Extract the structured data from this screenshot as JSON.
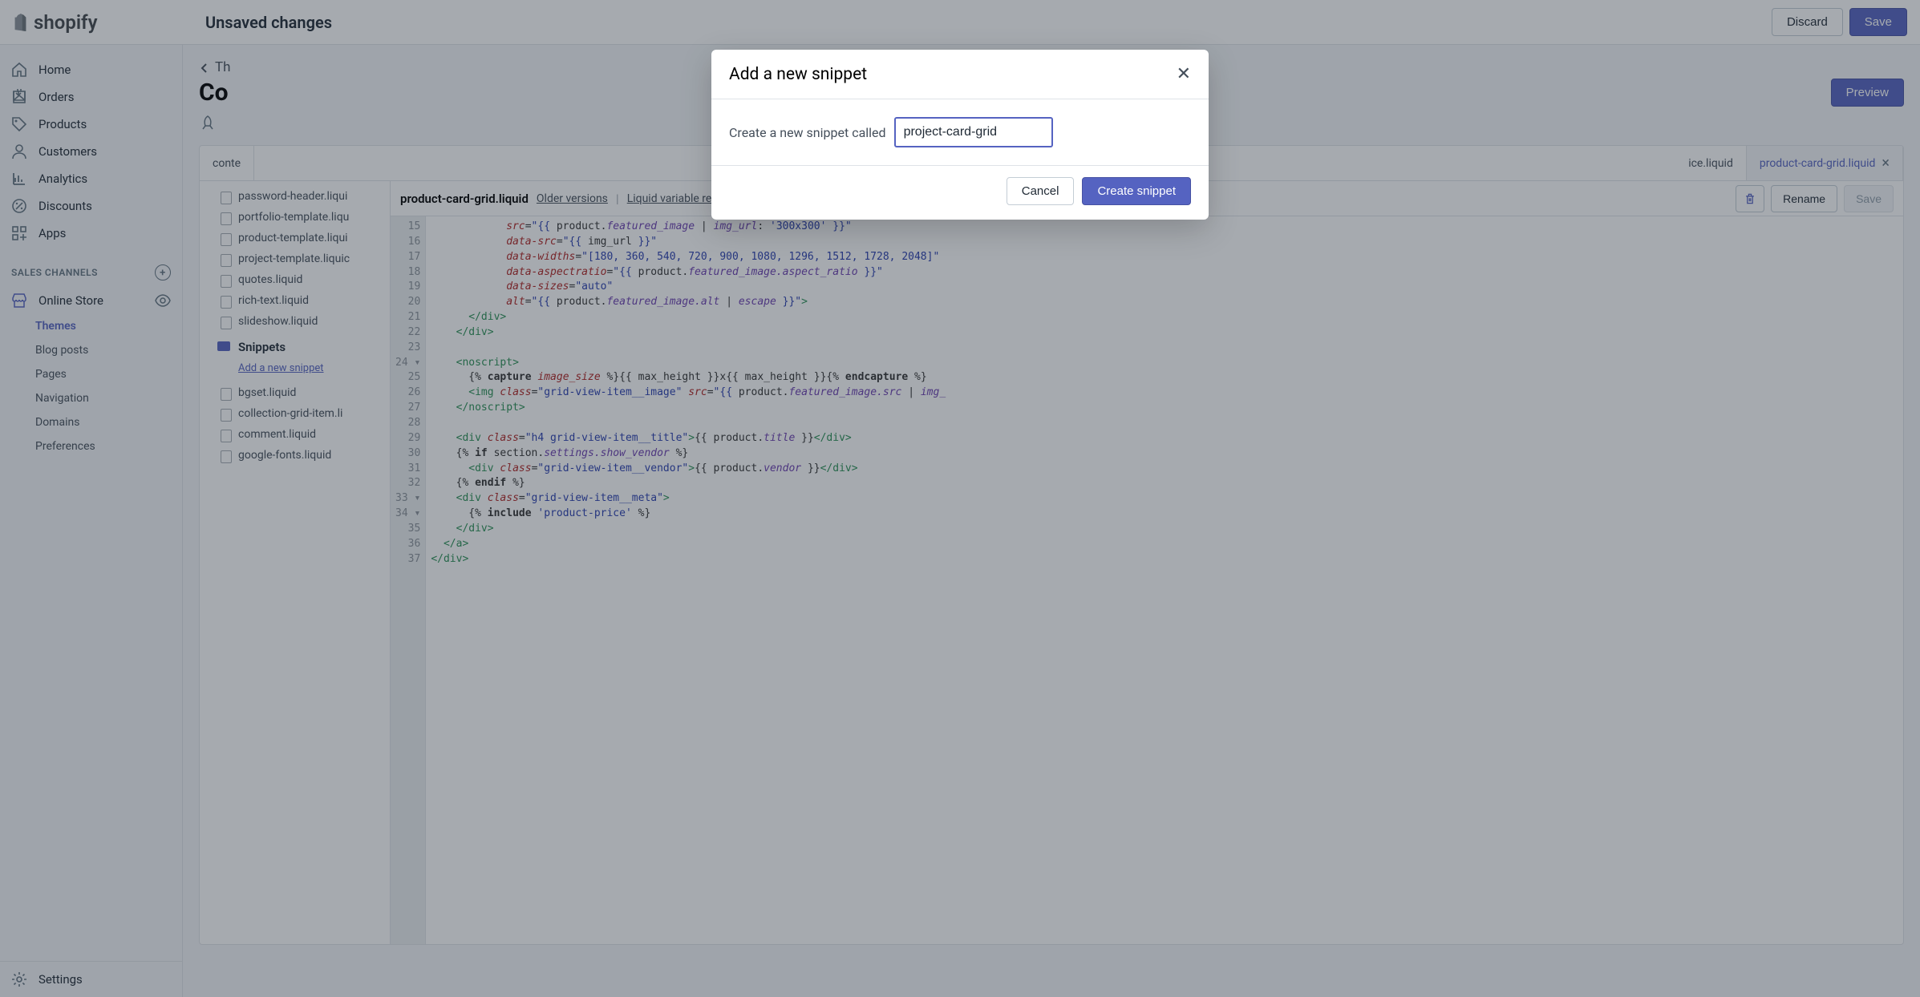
{
  "brand": "shopify",
  "header": {
    "unsaved": "Unsaved changes",
    "discard": "Discard",
    "save": "Save"
  },
  "sidebar": {
    "nav": [
      {
        "label": "Home"
      },
      {
        "label": "Orders"
      },
      {
        "label": "Products"
      },
      {
        "label": "Customers"
      },
      {
        "label": "Analytics"
      },
      {
        "label": "Discounts"
      },
      {
        "label": "Apps"
      }
    ],
    "channels_label": "SALES CHANNELS",
    "online_store": "Online Store",
    "online_sub": [
      {
        "label": "Themes",
        "selected": true
      },
      {
        "label": "Blog posts"
      },
      {
        "label": "Pages"
      },
      {
        "label": "Navigation"
      },
      {
        "label": "Domains"
      },
      {
        "label": "Preferences"
      }
    ],
    "settings": "Settings"
  },
  "page": {
    "back": "Th",
    "title": "Co",
    "preview": "Preview"
  },
  "editor": {
    "tabs": [
      {
        "label": "conte"
      },
      {
        "label": "ice.liquid"
      },
      {
        "label": "product-card-grid.liquid",
        "selected": true,
        "closable": true
      }
    ],
    "folder": "Snippets",
    "add_new": "Add a new snippet",
    "files_above": [
      "password-header.liqui",
      "portfolio-template.liqu",
      "product-template.liqui",
      "project-template.liquic",
      "quotes.liquid",
      "rich-text.liquid",
      "slideshow.liquid"
    ],
    "files_below": [
      "bgset.liquid",
      "collection-grid-item.li",
      "comment.liquid",
      "google-fonts.liquid"
    ],
    "filename": "product-card-grid.liquid",
    "older": "Older versions",
    "liquid_ref": "Liquid variable reference",
    "rename": "Rename",
    "save": "Save",
    "line_start": 15,
    "line_end": 37
  },
  "modal": {
    "title": "Add a new snippet",
    "label": "Create a new snippet called",
    "value": "project-card-grid",
    "cancel": "Cancel",
    "create": "Create snippet"
  }
}
